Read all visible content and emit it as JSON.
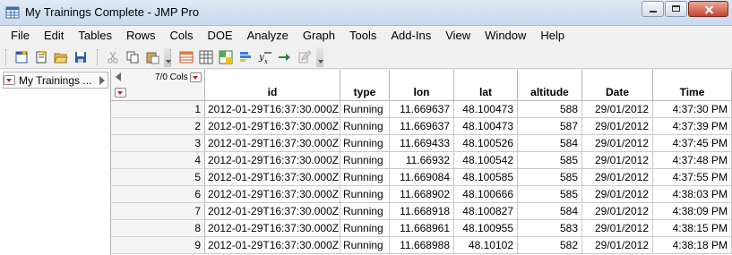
{
  "window": {
    "title": "My Trainings Complete - JMP Pro",
    "app_icon": "data-table-icon"
  },
  "menubar": [
    "File",
    "Edit",
    "Tables",
    "Rows",
    "Cols",
    "DOE",
    "Analyze",
    "Graph",
    "Tools",
    "Add-Ins",
    "View",
    "Window",
    "Help"
  ],
  "left_panel": {
    "table_name": "My Trainings ..."
  },
  "grid": {
    "cols_count": "7/0 Cols",
    "columns": [
      "id",
      "type",
      "lon",
      "lat",
      "altitude",
      "Date",
      "Time"
    ],
    "rows": [
      {
        "n": "1",
        "cells": [
          "2012-01-29T16:37:30.000Z",
          "Running",
          "11.669637",
          "48.100473",
          "588",
          "29/01/2012",
          "4:37:30 PM"
        ]
      },
      {
        "n": "2",
        "cells": [
          "2012-01-29T16:37:30.000Z",
          "Running",
          "11.669637",
          "48.100473",
          "587",
          "29/01/2012",
          "4:37:39 PM"
        ]
      },
      {
        "n": "3",
        "cells": [
          "2012-01-29T16:37:30.000Z",
          "Running",
          "11.669433",
          "48.100526",
          "584",
          "29/01/2012",
          "4:37:45 PM"
        ]
      },
      {
        "n": "4",
        "cells": [
          "2012-01-29T16:37:30.000Z",
          "Running",
          "11.66932",
          "48.100542",
          "585",
          "29/01/2012",
          "4:37:48 PM"
        ]
      },
      {
        "n": "5",
        "cells": [
          "2012-01-29T16:37:30.000Z",
          "Running",
          "11.669084",
          "48.100585",
          "585",
          "29/01/2012",
          "4:37:55 PM"
        ]
      },
      {
        "n": "6",
        "cells": [
          "2012-01-29T16:37:30.000Z",
          "Running",
          "11.668902",
          "48.100666",
          "585",
          "29/01/2012",
          "4:38:03 PM"
        ]
      },
      {
        "n": "7",
        "cells": [
          "2012-01-29T16:37:30.000Z",
          "Running",
          "11.668918",
          "48.100827",
          "584",
          "29/01/2012",
          "4:38:09 PM"
        ]
      },
      {
        "n": "8",
        "cells": [
          "2012-01-29T16:37:30.000Z",
          "Running",
          "11.668961",
          "48.100955",
          "583",
          "29/01/2012",
          "4:38:15 PM"
        ]
      },
      {
        "n": "9",
        "cells": [
          "2012-01-29T16:37:30.000Z",
          "Running",
          "11.668988",
          "48.10102",
          "582",
          "29/01/2012",
          "4:38:18 PM"
        ]
      }
    ]
  }
}
